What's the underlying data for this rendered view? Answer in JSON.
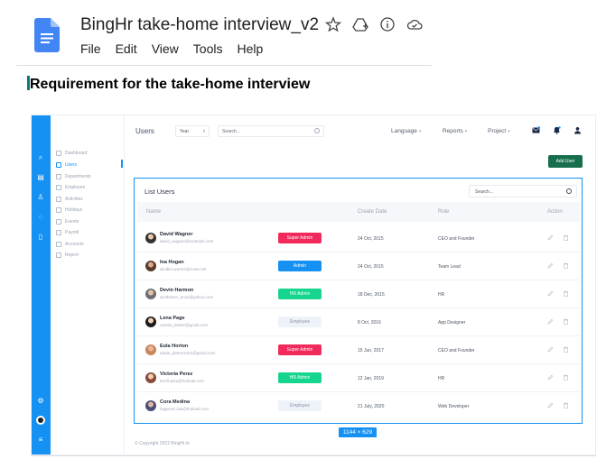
{
  "doc": {
    "title": "BingHr take-home interview_v2",
    "menu": [
      "File",
      "Edit",
      "View",
      "Tools",
      "Help"
    ],
    "title_icons": [
      "star-icon",
      "move-to-drive-icon",
      "info-icon",
      "cloud-saved-icon"
    ],
    "heading": "Requirement for the take-home interview"
  },
  "app": {
    "sidebar": {
      "items": [
        {
          "label": "Dashboard",
          "active": false
        },
        {
          "label": "Users",
          "active": true
        },
        {
          "label": "Departments",
          "active": false
        },
        {
          "label": "Employee",
          "active": false
        },
        {
          "label": "Activities",
          "active": false
        },
        {
          "label": "Holidays",
          "active": false
        },
        {
          "label": "Events",
          "active": false
        },
        {
          "label": "Payroll",
          "active": false
        },
        {
          "label": "Accounts",
          "active": false
        },
        {
          "label": "Report",
          "active": false
        }
      ]
    },
    "topbar": {
      "title": "Users",
      "year_label": "Year",
      "search_placeholder": "Search...",
      "menus": [
        "Language",
        "Reports",
        "Project"
      ]
    },
    "add_user_label": "Add User",
    "list": {
      "title": "List Users",
      "search_placeholder": "Search...",
      "columns": [
        "Name",
        "Create Date",
        "Role",
        "Action"
      ],
      "rows": [
        {
          "name": "David Wagner",
          "email": "david_wagner@example.com",
          "badge": "Super Admin",
          "badge_type": "super",
          "date": "24 Oct, 2015",
          "role": "CEO and Founder"
        },
        {
          "name": "Ina Hogan",
          "email": "windler.warren@runte.net",
          "badge": "Admin",
          "badge_type": "admin",
          "date": "24 Oct, 2015",
          "role": "Team Lead"
        },
        {
          "name": "Devin Harmon",
          "email": "wintheiser_enos@yahoo.com",
          "badge": "HR Admin",
          "badge_type": "hr",
          "date": "18 Dec, 2015",
          "role": "HR"
        },
        {
          "name": "Lena Page",
          "email": "camila_ledner@gmail.com",
          "badge": "Employee",
          "badge_type": "employee",
          "date": "8 Oct, 2016",
          "role": "App Designer"
        },
        {
          "name": "Eula Horton",
          "email": "edula_dorton1221@gmail.com",
          "badge": "Super Admin",
          "badge_type": "super",
          "date": "15 Jun, 2017",
          "role": "CEO and Founder"
        },
        {
          "name": "Victoria Perez",
          "email": "terrill.wiza@hotmail.com",
          "badge": "HR Admin",
          "badge_type": "hr",
          "date": "12 Jan, 2019",
          "role": "HR"
        },
        {
          "name": "Cora Medina",
          "email": "hagenes.isai@hotmail.com",
          "badge": "Employee",
          "badge_type": "employee",
          "date": "21 July, 2020",
          "role": "Web Developer"
        }
      ]
    },
    "copyright": "© Copyright 2022 BingHr.io"
  },
  "dimension_label": "1144 × 629",
  "colors": {
    "accent": "#1591f3",
    "super": "#f2295b",
    "admin": "#1591f3",
    "hr": "#16d68f",
    "employee": "#eef2f9",
    "add_user": "#176e4c"
  }
}
